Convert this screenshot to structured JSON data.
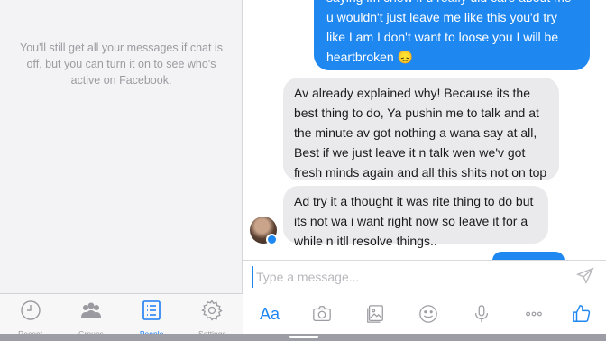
{
  "left_panel": {
    "chat_off_message": "You'll still get all your messages if chat is off, but you can turn it on to see who's active on Facebook.",
    "tabs": [
      {
        "label": "Recent",
        "icon": "clock-icon",
        "active": false
      },
      {
        "label": "Groups",
        "icon": "groups-icon",
        "active": false
      },
      {
        "label": "People",
        "icon": "people-list-icon",
        "active": true
      },
      {
        "label": "Settings",
        "icon": "gear-icon",
        "active": false
      }
    ]
  },
  "conversation": {
    "messages": [
      {
        "direction": "outgoing",
        "text": "saying im chew if u really did care about me u wouldn't just leave me like this you'd try like I am I don't want to loose you I will be heartbroken 😞"
      },
      {
        "direction": "incoming",
        "text": "Av already explained why! Because its the best thing to do, Ya pushin me to talk and at the minute av got nothing a wana say at all, Best if we just leave it n talk wen we'v got fresh minds again and all this shits not on top of us please!"
      },
      {
        "direction": "incoming",
        "text": "Ad try it a thought it was rite thing to do but its not wa i want right now so leave it for a while n itll resolve things.."
      }
    ]
  },
  "composer": {
    "placeholder": "Type a message...",
    "value": "",
    "aa_label": "Aa",
    "tools": [
      "camera-icon",
      "gallery-icon",
      "emoji-icon",
      "microphone-icon",
      "more-icon",
      "like-icon"
    ]
  },
  "colors": {
    "accent": "#1e87f0",
    "incoming_bubble": "#eaeaec",
    "panel_bg": "#f3f3f5"
  }
}
